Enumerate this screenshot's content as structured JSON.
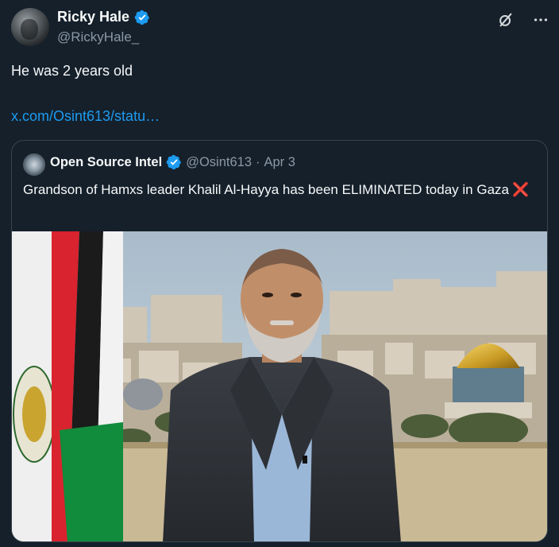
{
  "author": {
    "display_name": "Ricky Hale",
    "handle": "@RickyHale_",
    "avatar_icon": "profile-photo",
    "verified_icon": "verified-badge-icon"
  },
  "toolbar": {
    "grok_icon": "grok-icon",
    "more_icon": "more-options-icon"
  },
  "tweet": {
    "text": "He was 2 years old",
    "link": "x.com/Osint613/statu…"
  },
  "quoted": {
    "display_name": "Open Source Intel",
    "handle": "@Osint613",
    "separator": "·",
    "date": "Apr 3",
    "text": "Grandson of Hamxs leader Khalil Al-Hayya has been ELIMINATED today in Gaza",
    "emoji": "❌"
  },
  "colors": {
    "background": "#15202b",
    "text": "#f7f9f9",
    "secondary": "#8b98a5",
    "link": "#1d9bf0",
    "verified": "#1d9bf0",
    "border": "#38444d"
  }
}
